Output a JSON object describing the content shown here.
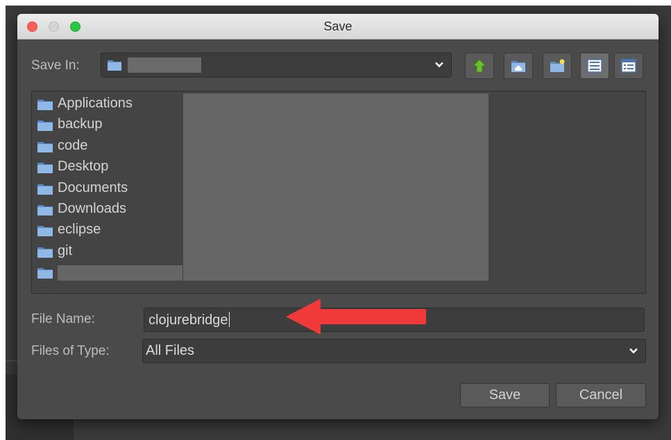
{
  "dialog": {
    "title": "Save"
  },
  "save_in": {
    "label": "Save In:",
    "toolbar_icons": [
      "up-folder-icon",
      "home-folder-icon",
      "new-folder-icon",
      "list-view-icon",
      "details-view-icon"
    ]
  },
  "file_list": {
    "items": [
      {
        "name": "Applications"
      },
      {
        "name": "backup"
      },
      {
        "name": "code"
      },
      {
        "name": "Desktop"
      },
      {
        "name": "Documents"
      },
      {
        "name": "Downloads"
      },
      {
        "name": "eclipse"
      },
      {
        "name": "git"
      }
    ]
  },
  "file_name": {
    "label": "File Name:",
    "value": "clojurebridge"
  },
  "file_type": {
    "label": "Files of Type:",
    "value": "All Files"
  },
  "buttons": {
    "save": "Save",
    "cancel": "Cancel"
  },
  "colors": {
    "dialog_bg": "#4a4a4a",
    "field_bg": "#3d3d3d",
    "folder_blue": "#7aa7d8",
    "annotation_arrow": "#f03a3a",
    "up_arrow_green": "#6fbe2c"
  }
}
